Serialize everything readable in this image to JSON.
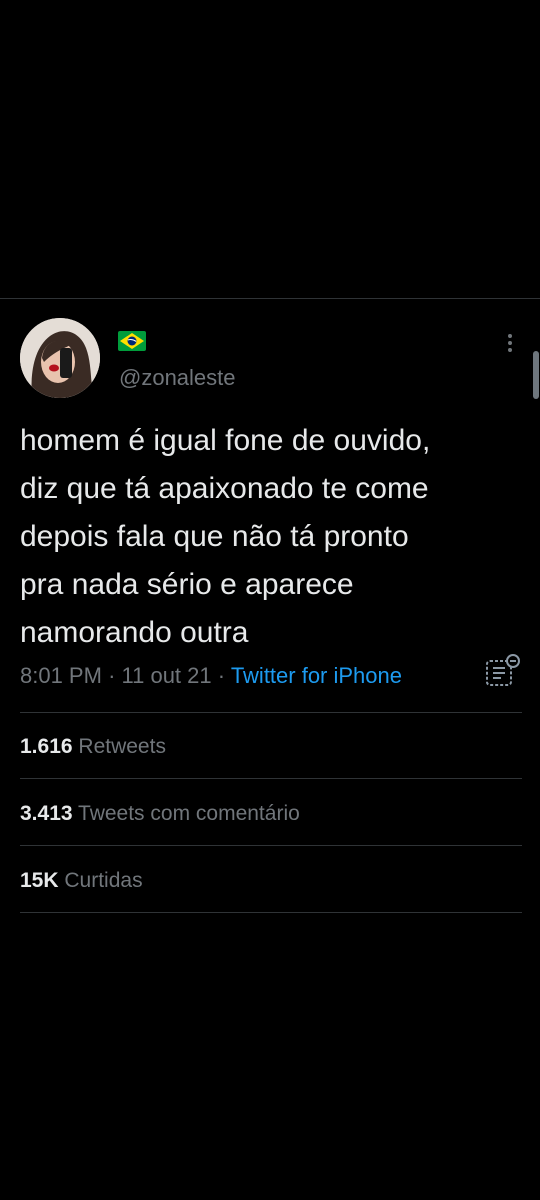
{
  "profile": {
    "flag_icon": "brazil-flag-icon",
    "handle": "@zonaleste"
  },
  "tweet": {
    "text": "homem é igual fone de ouvido,\ndiz que tá apaixonado te come\ndepois fala que não tá pronto\npra nada sério e aparece\nnamorando outra",
    "time": "8:01 PM",
    "separator": "·",
    "date": "11 out 21",
    "source": "Twitter for iPhone"
  },
  "stats": [
    {
      "count": "1.616",
      "label": "Retweets"
    },
    {
      "count": "3.413",
      "label": "Tweets com comentário"
    },
    {
      "count": "15K",
      "label": "Curtidas"
    }
  ],
  "colors": {
    "background": "#000000",
    "text": "#e7e9ea",
    "secondary": "#71767b",
    "accent": "#1d9bf0",
    "divider": "#2f3336"
  }
}
